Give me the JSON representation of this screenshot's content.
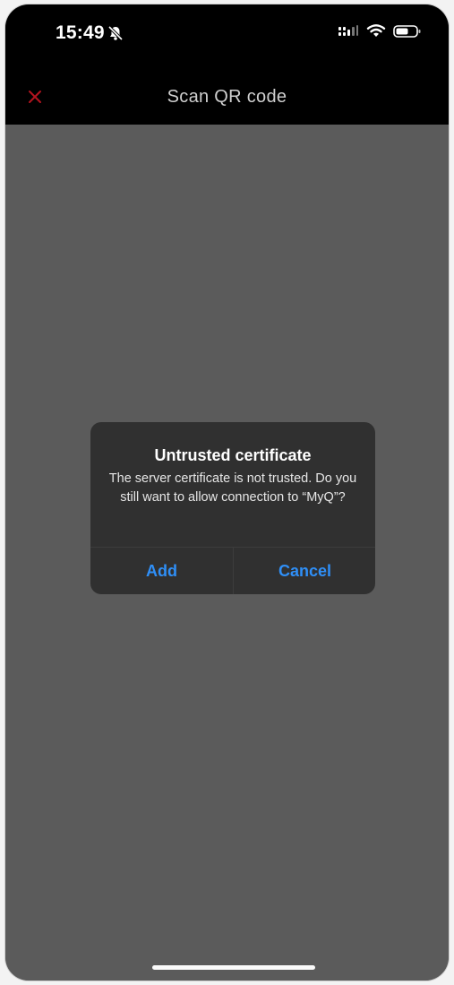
{
  "status_bar": {
    "time": "15:49",
    "icons": [
      "bell-slash-icon",
      "signal-icon",
      "wifi-icon",
      "battery-icon"
    ]
  },
  "nav": {
    "title": "Scan QR code",
    "close_icon": "close-icon",
    "close_color": "#b3141f"
  },
  "dialog": {
    "title": "Untrusted certificate",
    "message": "The server certificate is not trusted. Do you still want to allow connection to “MyQ”?",
    "add_label": "Add",
    "cancel_label": "Cancel",
    "accent_color": "#2f8ff7"
  }
}
